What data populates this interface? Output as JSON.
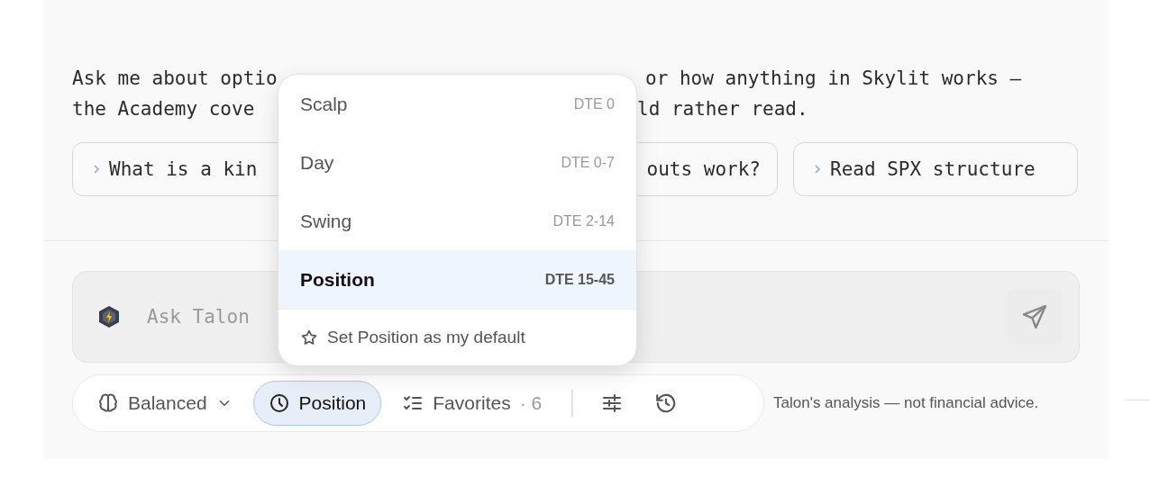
{
  "intro": {
    "lines": [
      {
        "left": "Ask me about optio",
        "right": "or how anything in Skylit works —"
      },
      {
        "left": "the Academy cove",
        "right": "ld rather read."
      }
    ]
  },
  "suggestions": [
    {
      "label": "What is a kin",
      "kind": "chevron"
    },
    {
      "label": "outs work?",
      "kind": "plain"
    },
    {
      "label": "Read SPX structure",
      "kind": "chevron"
    }
  ],
  "composer": {
    "placeholder": "Ask Talon"
  },
  "toolbar": {
    "mode": {
      "label": "Balanced"
    },
    "horizon": {
      "label": "Position",
      "open": true
    },
    "favorites": {
      "label": "Favorites",
      "count": "· 6"
    }
  },
  "disclaimer": "Talon's analysis — not financial advice.",
  "horizon_menu": {
    "items": [
      {
        "label": "Scalp",
        "dte": "DTE 0",
        "selected": false
      },
      {
        "label": "Day",
        "dte": "DTE 0-7",
        "selected": false
      },
      {
        "label": "Swing",
        "dte": "DTE 2-14",
        "selected": false
      },
      {
        "label": "Position",
        "dte": "DTE 15-45",
        "selected": true
      }
    ],
    "footer": "Set Position as my default"
  }
}
